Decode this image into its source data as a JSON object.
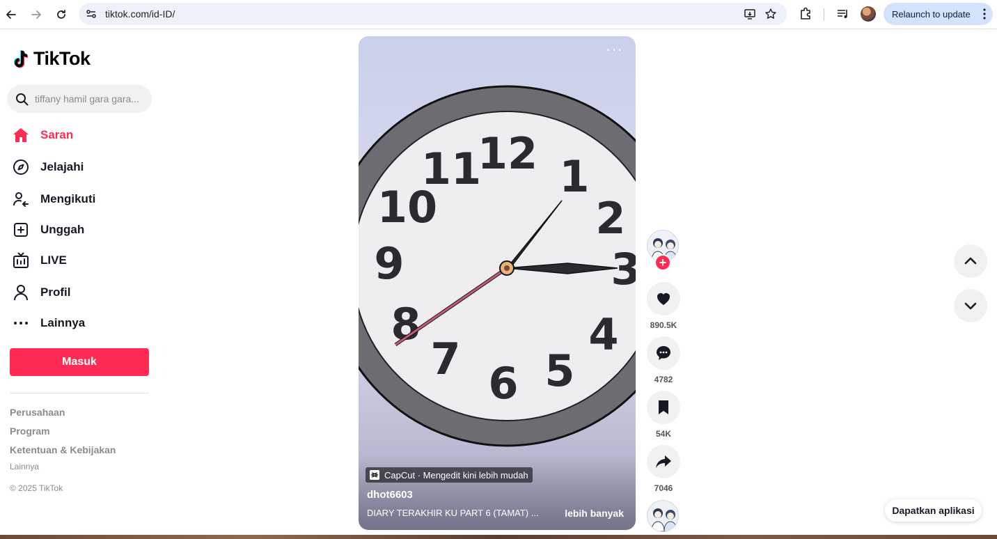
{
  "browser": {
    "url": "tiktok.com/id-ID/",
    "relaunch_label": "Relaunch to update"
  },
  "sidebar": {
    "logo_text": "TikTok",
    "search_placeholder": "tiffany hamil gara gara...",
    "nav": [
      {
        "label": "Saran",
        "icon": "home-icon",
        "active": true
      },
      {
        "label": "Jelajahi",
        "icon": "compass-icon"
      },
      {
        "label": "Mengikuti",
        "icon": "following-icon"
      },
      {
        "label": "Unggah",
        "icon": "upload-icon"
      },
      {
        "label": "LIVE",
        "icon": "live-icon"
      },
      {
        "label": "Profil",
        "icon": "profile-icon"
      },
      {
        "label": "Lainnya",
        "icon": "more-icon"
      }
    ],
    "login_label": "Masuk",
    "footer": {
      "links": [
        "Perusahaan",
        "Program",
        "Ketentuan & Kebijakan"
      ],
      "more": "Lainnya",
      "copyright": "© 2025 TikTok"
    }
  },
  "video": {
    "capcut_label": "CapCut · Mengedit kini lebih mudah",
    "username": "dhot6603",
    "caption": "DIARY TERAKHIR KU PART 6 (TAMAT) ...",
    "see_more": "lebih banyak",
    "clock_numbers": [
      "12",
      "1",
      "2",
      "3",
      "4",
      "5",
      "6",
      "7",
      "8",
      "9",
      "10",
      "11"
    ]
  },
  "actions": {
    "likes": "890.5K",
    "comments": "4782",
    "saves": "54K",
    "shares": "7046"
  },
  "get_app_label": "Dapatkan aplikasi",
  "colors": {
    "brand": "#fe2c55",
    "text": "#161823",
    "muted": "#8a8b91"
  }
}
